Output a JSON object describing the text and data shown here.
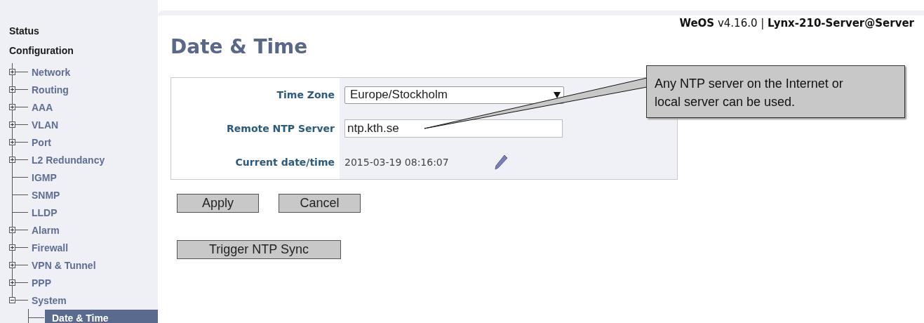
{
  "header": "**WeOS** v4.16.0 | **Lynx-210-Server@Server**",
  "sidebar": {
    "links": [
      "Status",
      "Configuration"
    ],
    "tree": [
      {
        "label": "Network",
        "expanded": false,
        "selected": false
      },
      {
        "label": "Routing",
        "expanded": false,
        "selected": false
      },
      {
        "label": "AAA",
        "expanded": false,
        "selected": false
      },
      {
        "label": "VLAN",
        "expanded": false,
        "selected": false
      },
      {
        "label": "Port",
        "expanded": false,
        "selected": false
      },
      {
        "label": "L2 Redundancy",
        "expanded": false,
        "selected": false
      },
      {
        "label": "IGMP",
        "selected": false
      },
      {
        "label": "SNMP",
        "selected": false
      },
      {
        "label": "LLDP",
        "selected": false
      },
      {
        "label": "Alarm",
        "expanded": false,
        "selected": false
      },
      {
        "label": "Firewall",
        "expanded": false,
        "selected": false
      },
      {
        "label": "VPN & Tunnel",
        "expanded": false,
        "selected": false
      },
      {
        "label": "PPP",
        "expanded": false,
        "selected": false
      },
      {
        "label": "System",
        "expanded": true,
        "selected": false,
        "children": [
          {
            "label": "Date & Time",
            "selected": true
          }
        ]
      }
    ]
  },
  "page_title": "Date & Time",
  "form": [
    {
      "label": "Time Zone",
      "kind": "select",
      "value": "Europe/Stockholm"
    },
    {
      "label": "Remote NTP Server",
      "kind": "input",
      "value": "ntp.kth.se"
    },
    {
      "label": "Current date/time",
      "kind": "text",
      "value": "2015-03-19 08:16:07"
    }
  ],
  "buttons": [
    "Apply",
    "Cancel"
  ],
  "sync_button": "Trigger NTP Sync",
  "callout": "Any NTP server on the Internet or local server can be used."
}
